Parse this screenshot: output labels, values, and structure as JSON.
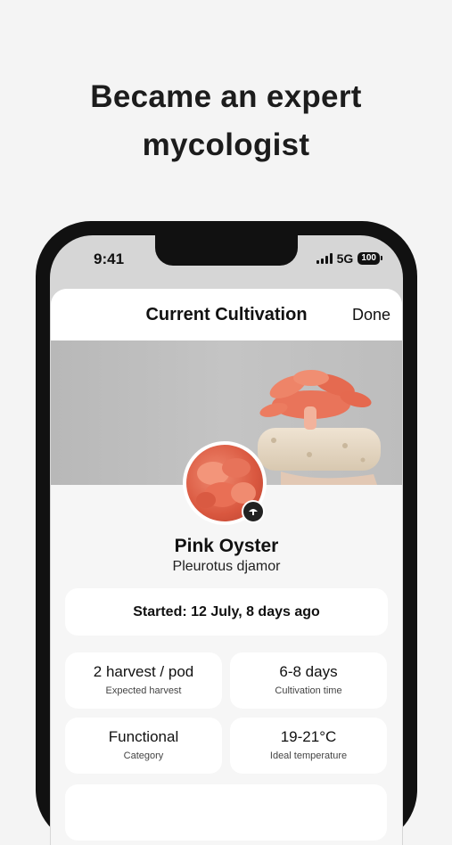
{
  "headline": {
    "line1": "Became an expert",
    "line2": "mycologist"
  },
  "status_bar": {
    "time": "9:41",
    "network": "5G",
    "battery": "100"
  },
  "sheet": {
    "title": "Current Cultivation",
    "done_label": "Done"
  },
  "species": {
    "name": "Pink Oyster",
    "latin": "Pleurotus djamor"
  },
  "started": "Started: 12 July, 8 days ago",
  "stats": [
    {
      "value": "2 harvest / pod",
      "label": "Expected harvest"
    },
    {
      "value": "6-8 days",
      "label": "Cultivation time"
    },
    {
      "value": "Functional",
      "label": "Category"
    },
    {
      "value": "19-21°C",
      "label": "Ideal temperature"
    }
  ],
  "colors": {
    "accent": "#e2664c",
    "background": "#f4f4f4",
    "phone_frame": "#111111"
  }
}
